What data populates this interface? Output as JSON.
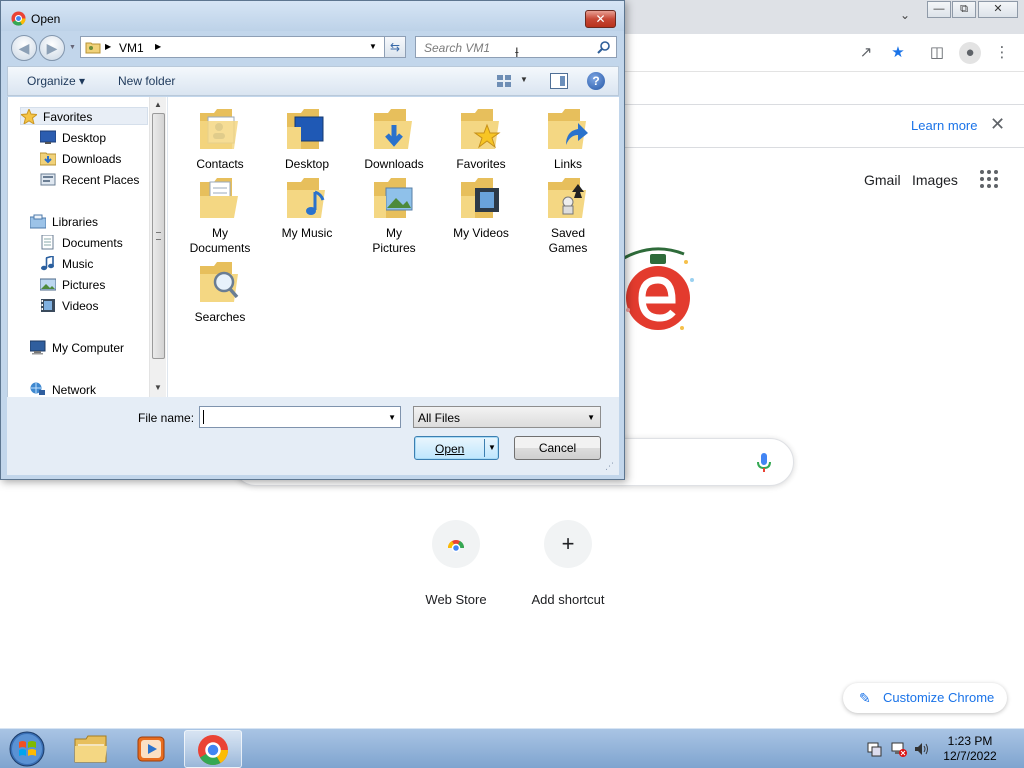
{
  "browser": {
    "infobar": {
      "learn_more": "Learn more"
    },
    "header_links": {
      "gmail": "Gmail",
      "images": "Images"
    },
    "shortcuts": [
      {
        "label": "Web Store",
        "icon": "chrome-web-store-icon"
      },
      {
        "label": "Add shortcut",
        "icon": "plus-icon",
        "glyph": "+"
      }
    ],
    "customize_label": "Customize Chrome"
  },
  "dialog": {
    "title": "Open",
    "address": {
      "segments": [
        "VM1"
      ]
    },
    "search_placeholder": "Search VM1",
    "commands": {
      "organize": "Organize",
      "new_folder": "New folder"
    },
    "nav_items": [
      {
        "label": "Favorites",
        "icon": "star-icon"
      },
      {
        "label": "Desktop",
        "icon": "desktop-icon"
      },
      {
        "label": "Downloads",
        "icon": "downloads-icon"
      },
      {
        "label": "Recent Places",
        "icon": "recent-places-icon"
      },
      {
        "label": "Libraries",
        "icon": "libraries-icon"
      },
      {
        "label": "Documents",
        "icon": "documents-icon"
      },
      {
        "label": "Music",
        "icon": "music-icon"
      },
      {
        "label": "Pictures",
        "icon": "pictures-icon"
      },
      {
        "label": "Videos",
        "icon": "videos-icon"
      },
      {
        "label": "My Computer",
        "icon": "computer-icon"
      },
      {
        "label": "Network",
        "icon": "network-icon"
      }
    ],
    "folders": [
      {
        "label": "Contacts",
        "icon": "contacts-folder-icon"
      },
      {
        "label": "Desktop",
        "icon": "desktop-folder-icon"
      },
      {
        "label": "Downloads",
        "icon": "downloads-folder-icon"
      },
      {
        "label": "Favorites",
        "icon": "favorites-folder-icon"
      },
      {
        "label": "Links",
        "icon": "links-folder-icon"
      },
      {
        "label": "My Documents",
        "icon": "documents-folder-icon"
      },
      {
        "label": "My Music",
        "icon": "music-folder-icon"
      },
      {
        "label": "My Pictures",
        "icon": "pictures-folder-icon"
      },
      {
        "label": "My Videos",
        "icon": "videos-folder-icon"
      },
      {
        "label": "Saved Games",
        "icon": "saved-games-folder-icon"
      },
      {
        "label": "Searches",
        "icon": "searches-folder-icon"
      }
    ],
    "file_name_label": "File name:",
    "file_name_value": "",
    "file_type": "All Files",
    "open_label": "Open",
    "cancel_label": "Cancel"
  },
  "taskbar": {
    "items": [
      {
        "name": "windows-start-icon"
      },
      {
        "name": "file-explorer-icon"
      },
      {
        "name": "media-player-icon"
      },
      {
        "name": "chrome-icon",
        "active": true
      }
    ],
    "clock": {
      "time": "1:23 PM",
      "date": "12/7/2022"
    }
  },
  "colors": {
    "chrome_accent": "#1a73e8",
    "dialog_frame": "#c2d6eb",
    "taskbar": "#8fb2da"
  }
}
